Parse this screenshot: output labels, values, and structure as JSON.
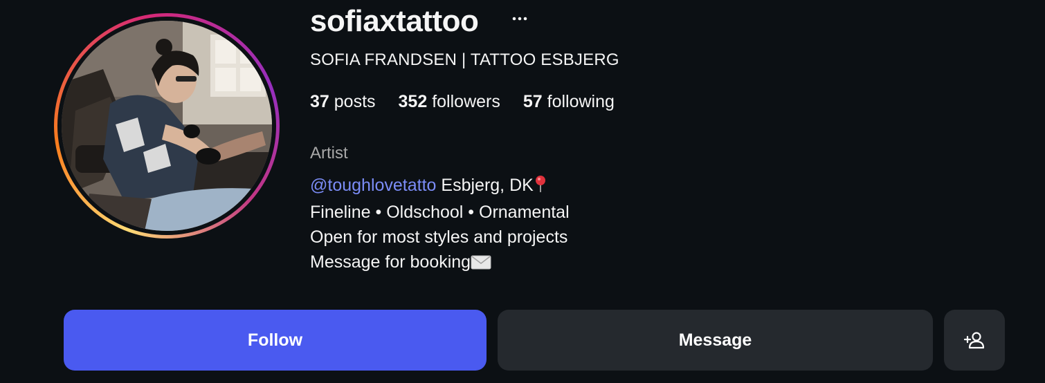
{
  "profile": {
    "username": "sofiaxtattoo",
    "full_name": "SOFIA FRANDSEN | TATTOO ESBJERG",
    "avatar_icon": "profile-photo-tattoo-artist",
    "more_icon": "more-options-icon"
  },
  "stats": {
    "posts_count": "37",
    "posts_label": "posts",
    "followers_count": "352",
    "followers_label": "followers",
    "following_count": "57",
    "following_label": "following"
  },
  "bio": {
    "category": "Artist",
    "mention": "@toughlovetatto",
    "location": "Esbjerg, DK",
    "location_icon": "round-pushpin-emoji",
    "line2": "Fineline • Oldschool • Ornamental",
    "line3": "Open for most styles and projects",
    "line4": "Message for booking",
    "line4_icon": "envelope-emoji"
  },
  "actions": {
    "follow_label": "Follow",
    "message_label": "Message",
    "suggest_icon": "add-person-icon"
  },
  "colors": {
    "background": "#0c1014",
    "follow_button": "#4a5af0",
    "secondary_button": "#25292e",
    "mention_link": "#7b8cf6",
    "muted_text": "#a8a8a8"
  }
}
